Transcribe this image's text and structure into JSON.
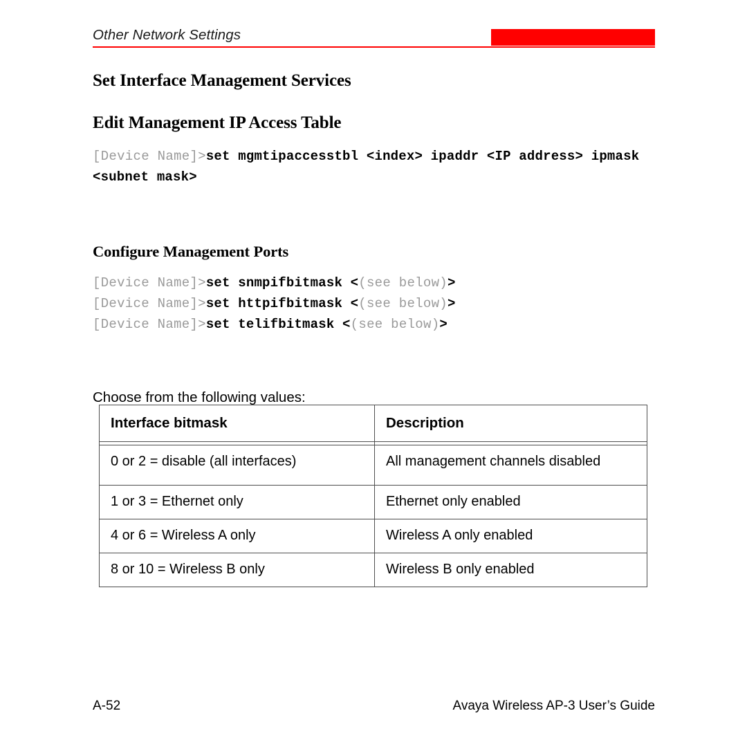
{
  "header": {
    "running_title": "Other Network Settings",
    "rule_color": "#ff0000",
    "block_color": "#ff0000"
  },
  "headings": {
    "h1_a": "Set Interface Management Services",
    "h1_b": "Edit Management IP Access Table",
    "h2_a": "Configure Management Ports"
  },
  "command_block_1": {
    "lines": [
      {
        "prompt": "[Device Name]>",
        "command": "set mgmtipaccesstbl <index> ipaddr <IP address> ipmask <subnet mask>"
      }
    ]
  },
  "command_block_2": {
    "lines": [
      {
        "prompt": "[Device Name]>",
        "command": "set snmpifbitmask <",
        "arg_dim": "(see below)",
        "command_tail": ">"
      },
      {
        "prompt": "[Device Name]>",
        "command": "set httpifbitmask <",
        "arg_dim": "(see below)",
        "command_tail": ">"
      },
      {
        "prompt": "[Device Name]>",
        "command": "set telifbitmask <",
        "arg_dim": "(see below)",
        "command_tail": ">"
      }
    ]
  },
  "body": {
    "intro": "Choose from the following values:"
  },
  "table": {
    "columns": [
      "Interface bitmask",
      "Description"
    ],
    "rows": [
      {
        "bitmask": "0 or 2 = disable (all interfaces)",
        "description": "All management channels disabled"
      },
      {
        "bitmask": "1 or 3 = Ethernet only",
        "description": "Ethernet only enabled"
      },
      {
        "bitmask": "4 or 6 = Wireless A only",
        "description": "Wireless A only enabled"
      },
      {
        "bitmask": "8 or 10 = Wireless B only",
        "description": "Wireless B only enabled"
      }
    ]
  },
  "footer": {
    "page_number": "A-52",
    "document_title": "Avaya Wireless AP-3 User’s Guide"
  }
}
